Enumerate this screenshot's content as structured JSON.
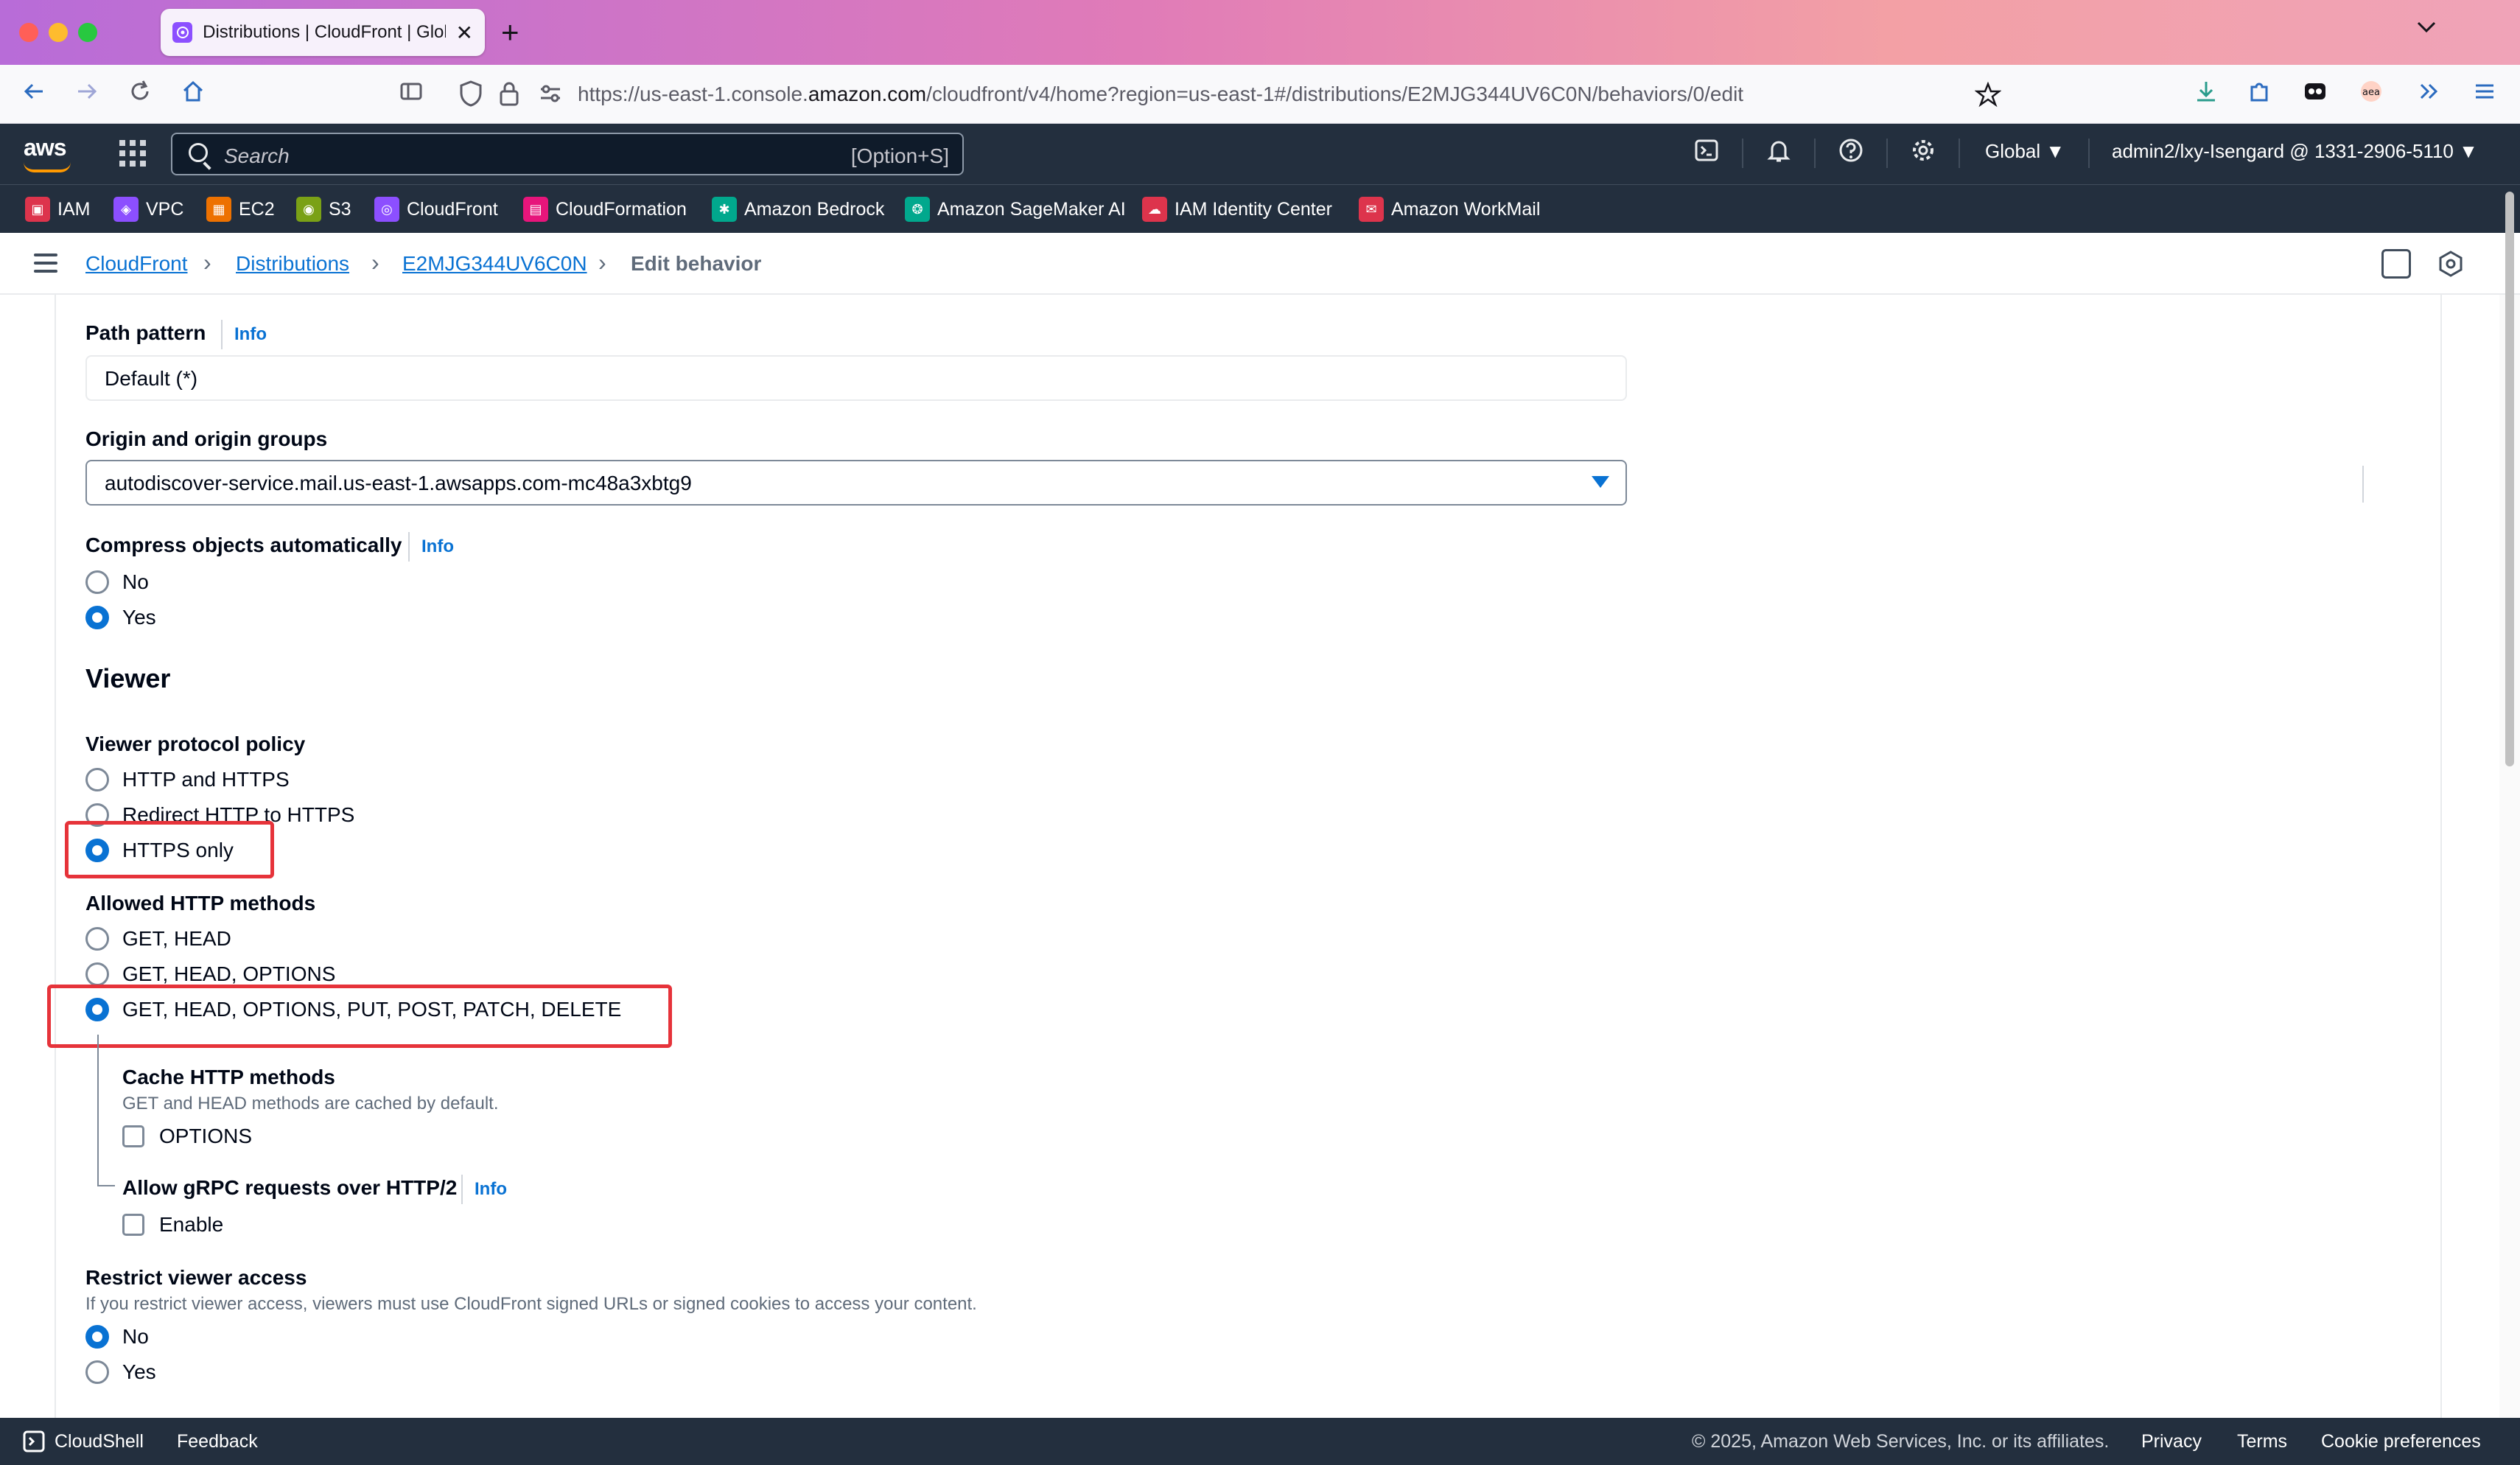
{
  "browser": {
    "tab_title": "Distributions | CloudFront | Glob",
    "url_prefix": "https://us-east-1.console.",
    "url_domain": "amazon.com",
    "url_suffix": "/cloudfront/v4/home?region=us-east-1#/distributions/E2MJG344UV6C0N/behaviors/0/edit",
    "new_tab_glyph": "+",
    "icons": [
      "back-icon",
      "forward-icon",
      "reload-icon",
      "home-icon",
      "sidebar-icon",
      "shield-icon",
      "lock-icon",
      "permissions-icon",
      "bookmark-star-icon",
      "download-icon",
      "extensions-icon",
      "app-icon",
      "translate-icon",
      "more-tools-icon",
      "menu-icon"
    ]
  },
  "aws_header": {
    "logo": "aws",
    "search_placeholder": "Search",
    "search_shortcut": "[Option+S]",
    "region": "Global",
    "account": "admin2/lxy-Isengard @ 1331-2906-5110"
  },
  "favorites": [
    {
      "label": "IAM",
      "color": "#dd344c"
    },
    {
      "label": "VPC",
      "color": "#8c4fff"
    },
    {
      "label": "EC2",
      "color": "#ed7100"
    },
    {
      "label": "S3",
      "color": "#7aa116"
    },
    {
      "label": "CloudFront",
      "color": "#8c4fff"
    },
    {
      "label": "CloudFormation",
      "color": "#e7157b"
    },
    {
      "label": "Amazon Bedrock",
      "color": "#01a88d"
    },
    {
      "label": "Amazon SageMaker AI",
      "color": "#01a88d"
    },
    {
      "label": "IAM Identity Center",
      "color": "#dd344c"
    },
    {
      "label": "Amazon WorkMail",
      "color": "#dd344c"
    }
  ],
  "breadcrumb": {
    "items": [
      "CloudFront",
      "Distributions",
      "E2MJG344UV6C0N"
    ],
    "current": "Edit behavior"
  },
  "form": {
    "path_pattern": {
      "label": "Path pattern",
      "info": "Info",
      "value": "Default (*)"
    },
    "origin": {
      "label": "Origin and origin groups",
      "value": "autodiscover-service.mail.us-east-1.awsapps.com-mc48a3xbtg9"
    },
    "compress": {
      "label": "Compress objects automatically",
      "info": "Info",
      "options": [
        "No",
        "Yes"
      ],
      "selected": "Yes"
    },
    "viewer_heading": "Viewer",
    "viewer_protocol": {
      "label": "Viewer protocol policy",
      "options": [
        "HTTP and HTTPS",
        "Redirect HTTP to HTTPS",
        "HTTPS only"
      ],
      "selected": "HTTPS only"
    },
    "allowed_methods": {
      "label": "Allowed HTTP methods",
      "options": [
        "GET, HEAD",
        "GET, HEAD, OPTIONS",
        "GET, HEAD, OPTIONS, PUT, POST, PATCH, DELETE"
      ],
      "selected": "GET, HEAD, OPTIONS, PUT, POST, PATCH, DELETE"
    },
    "cache_methods": {
      "label": "Cache HTTP methods",
      "description": "GET and HEAD methods are cached by default.",
      "checkbox": "OPTIONS",
      "checked": false
    },
    "grpc": {
      "label": "Allow gRPC requests over HTTP/2",
      "info": "Info",
      "checkbox": "Enable",
      "checked": false
    },
    "restrict_access": {
      "label": "Restrict viewer access",
      "description": "If you restrict viewer access, viewers must use CloudFront signed URLs or signed cookies to access your content.",
      "options": [
        "No",
        "Yes"
      ],
      "selected": "No"
    }
  },
  "annotation_color": "#e6333a",
  "footer": {
    "cloudshell": "CloudShell",
    "feedback": "Feedback",
    "copyright": "© 2025, Amazon Web Services, Inc. or its affiliates.",
    "privacy": "Privacy",
    "terms": "Terms",
    "cookies": "Cookie preferences"
  }
}
